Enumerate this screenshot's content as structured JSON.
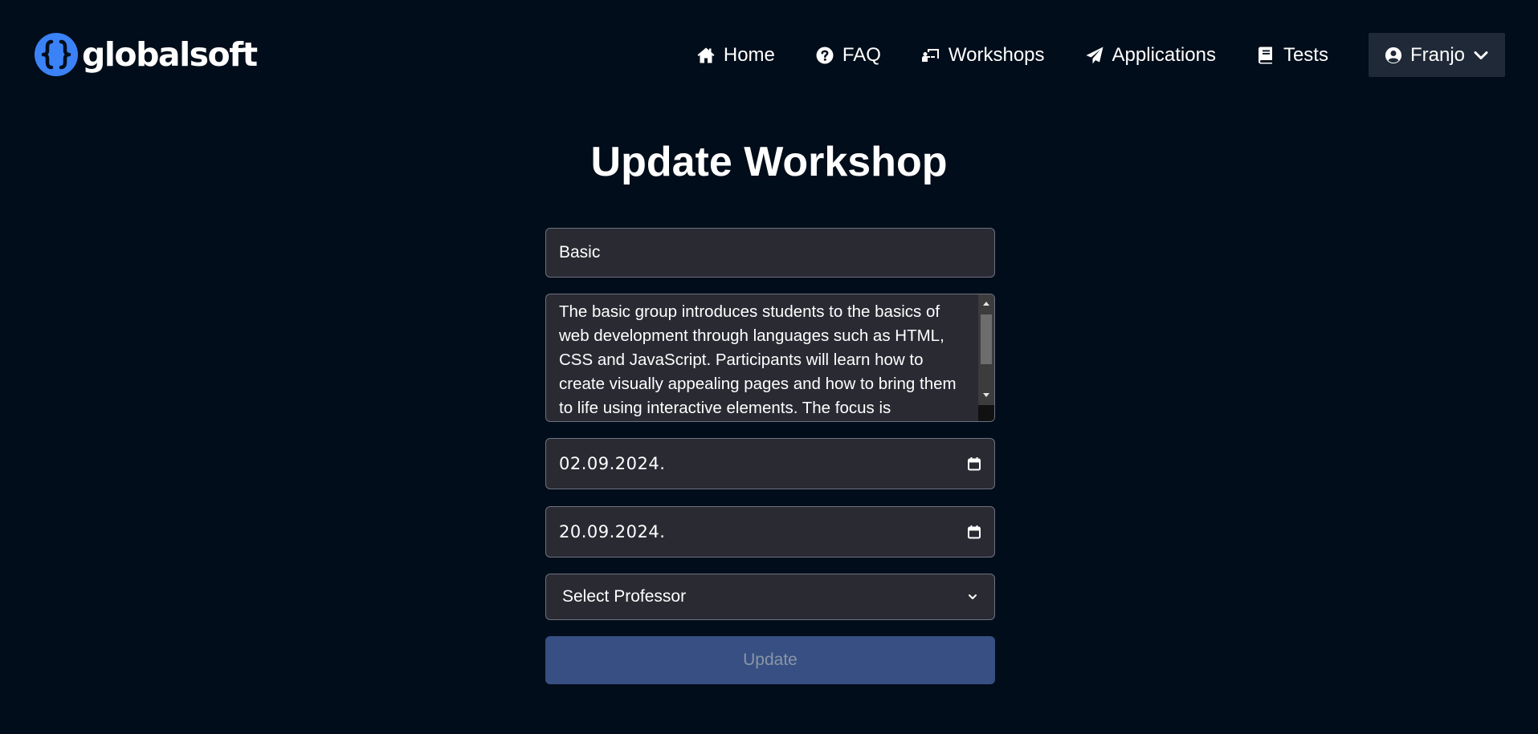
{
  "brand": {
    "name": "globalsoft"
  },
  "nav": {
    "items": [
      {
        "label": "Home",
        "icon": "home-icon"
      },
      {
        "label": "FAQ",
        "icon": "question-circle-icon"
      },
      {
        "label": "Workshops",
        "icon": "chalkboard-teacher-icon"
      },
      {
        "label": "Applications",
        "icon": "paper-plane-icon"
      },
      {
        "label": "Tests",
        "icon": "book-icon"
      }
    ],
    "user": {
      "name": "Franjo",
      "icon": "user-circle-icon"
    }
  },
  "page": {
    "title": "Update Workshop"
  },
  "form": {
    "name_value": "Basic",
    "description_value": "The basic group introduces students to the basics of web development through languages such as HTML, CSS and JavaScript. Participants will learn how to create visually appealing pages and how to bring them to life using interactive elements. The focus is",
    "start_date_value": "02.09.2024.",
    "end_date_value": "20.09.2024.",
    "professor_select_value": "Select Professor",
    "submit_label": "Update"
  },
  "colors": {
    "background": "#010d1a",
    "field_background": "#2a2a33",
    "field_border": "#6b7280",
    "button_background": "#374f82",
    "button_text": "#8b95a8",
    "user_menu_background": "#1f2937",
    "logo_blue": "#3b82f6"
  }
}
